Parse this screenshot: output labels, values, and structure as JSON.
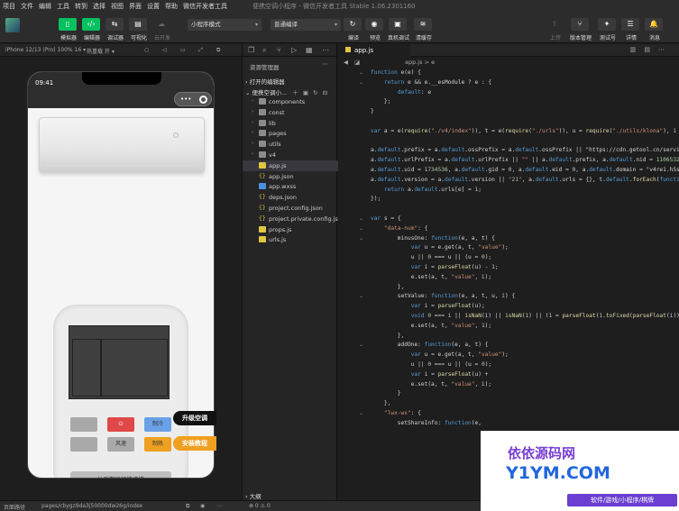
{
  "menu": [
    "项目",
    "文件",
    "编辑",
    "工具",
    "转到",
    "选择",
    "视图",
    "界面",
    "设置",
    "帮助",
    "微信开发者工具"
  ],
  "window_title": "便携空调小程序 - 微信开发者工具 Stable 1.06.2301160",
  "toolbar": {
    "simulator": "模拟器",
    "editor": "编辑器",
    "debugger": "调试器",
    "visual": "可视化",
    "cloud": "云开发",
    "mode": "小程序模式",
    "compile_mode": "普通编译",
    "compile": "编译",
    "preview": "预览",
    "real_debug": "真机调试",
    "clear_cache": "清缓存",
    "upload": "上传",
    "version": "版本管理",
    "test": "测试号",
    "detail": "详情",
    "message": "消息"
  },
  "simulator": {
    "device": "iPhone 12/13 (Pro) 100% 16 ▾",
    "hotreload": "热重载 开 ▾",
    "time": "09:41",
    "share_label": "让群友远程快凉快",
    "buttons": {
      "cold": "制冷",
      "wind": "风速",
      "heat": "制热"
    },
    "upgrade": "升级空调",
    "tutorial": "安装教程"
  },
  "explorer": {
    "title": "资源管理器",
    "open_editors": "打开的编辑器",
    "project": "便携空调小...",
    "outline": "大纲",
    "files": [
      {
        "name": "components",
        "type": "folder"
      },
      {
        "name": "const",
        "type": "folder"
      },
      {
        "name": "lib",
        "type": "folder"
      },
      {
        "name": "pages",
        "type": "folder"
      },
      {
        "name": "utils",
        "type": "folder"
      },
      {
        "name": "v4",
        "type": "folder"
      },
      {
        "name": "app.js",
        "type": "js",
        "active": true
      },
      {
        "name": "app.json",
        "type": "json"
      },
      {
        "name": "app.wxss",
        "type": "wxss"
      },
      {
        "name": "deps.json",
        "type": "json"
      },
      {
        "name": "project.config.json",
        "type": "json"
      },
      {
        "name": "project.private.config.js...",
        "type": "json"
      },
      {
        "name": "props.js",
        "type": "js"
      },
      {
        "name": "urls.js",
        "type": "js"
      }
    ]
  },
  "editor": {
    "tab": "app.js",
    "breadcrumb": "app.js > e",
    "lines": [
      "function e(e) {",
      "    return e && e.__esModule ? e : {",
      "        default: e",
      "    };",
      "}",
      "",
      "var a = e(require(\"./v4/index\")), t = e(require(\"./urls\")), u = require(\"./utils/klona\"), i = e(re",
      "",
      "a.default.prefix = a.default.ossPrefix = a.default.ossPrefix || \"https://cdn.getool.cn/service/fi",
      "a.default.urlPrefix = a.default.urlPrefix || \"\" || a.default.prefix, a.default.nid = 11065326,",
      "a.default.uid = 1734536, a.default.gid = 0, a.default.eid = 0, a.default.domain = \"v4re1.h5sys.cn",
      "a.default.version = a.default.version || \"21\", a.default.urls = {}, t.default.forEach(function(e)",
      "    return a.default.urls[e] = 1;",
      "});",
      "",
      "var s = {",
      "    \"data-num\": {",
      "        minusOne: function(e, a, t) {",
      "            var u = e.get(a, t, \"value\");",
      "            u || 0 === u || (u = 0);",
      "            var i = parseFloat(u) - 1;",
      "            e.set(a, t, \"value\", i);",
      "        },",
      "        setValue: function(e, a, t, u, i) {",
      "            var i = parseFloat(u);",
      "            void 0 === i || isNaN(i) || isNaN(1) || (1 = parseFloat(1.toFixed(parseFloat(i)))),",
      "            e.set(a, t, \"value\", 1);",
      "        },",
      "        addOne: function(e, a, t) {",
      "            var u = e.get(a, t, \"value\");",
      "            u || 0 === u || (u = 0);",
      "            var i = parseFloat(u) +",
      "            e.set(a, t, \"value\", i);",
      "        }",
      "    },",
      "    \"lwx-wx\": {",
      "        setShareInfo: function(e,"
    ]
  },
  "statusbar": {
    "path_label": "页面路径",
    "path": "pages/cbygz9da3j50000dw26g/index",
    "problems": "⊗ 0 ⚠ 0"
  },
  "watermark": {
    "line1": "依依源码网",
    "line2": "Y1YM.COM",
    "line3": "软件/游戏/小程序/棋牌"
  }
}
